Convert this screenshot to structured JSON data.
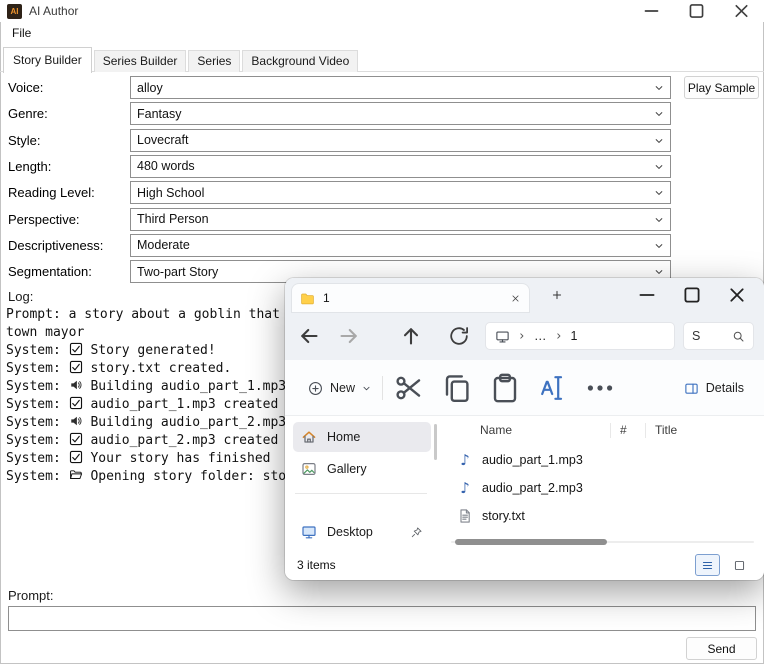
{
  "colors": {
    "accent_blue": "#2e62a8",
    "logo_orange": "#f0952e",
    "folder_yellow": "#ffd04a"
  },
  "app": {
    "title": "AI Author",
    "logo": "AI",
    "menu_items": [
      "File"
    ],
    "tabs": [
      "Story Builder",
      "Series Builder",
      "Series",
      "Background Video"
    ],
    "active_tab_index": 0,
    "fields": [
      {
        "label": "Voice:",
        "value": "alloy"
      },
      {
        "label": "Genre:",
        "value": "Fantasy"
      },
      {
        "label": "Style:",
        "value": "Lovecraft"
      },
      {
        "label": "Length:",
        "value": "480 words"
      },
      {
        "label": "Reading Level:",
        "value": "High School"
      },
      {
        "label": "Perspective:",
        "value": "Third Person"
      },
      {
        "label": "Descriptiveness:",
        "value": "Moderate"
      },
      {
        "label": "Segmentation:",
        "value": "Two-part Story"
      }
    ],
    "play_sample": "Play Sample",
    "log_label": "Log:",
    "log_lines": [
      {
        "prefix": "",
        "icon": null,
        "text": "Prompt: a story about a goblin that"
      },
      {
        "prefix": "",
        "icon": null,
        "text": "town mayor"
      },
      {
        "prefix": "System: ",
        "icon": "check",
        "text": "Story generated!"
      },
      {
        "prefix": "System: ",
        "icon": "check",
        "text": "story.txt created."
      },
      {
        "prefix": "System: ",
        "icon": "speaker",
        "text": "Building audio_part_1.mp3"
      },
      {
        "prefix": "System: ",
        "icon": "check",
        "text": "audio_part_1.mp3 created"
      },
      {
        "prefix": "System: ",
        "icon": "speaker",
        "text": "Building audio_part_2.mp3"
      },
      {
        "prefix": "System: ",
        "icon": "check",
        "text": "audio_part_2.mp3 created"
      },
      {
        "prefix": "System: ",
        "icon": "check",
        "text": "Your story has finished"
      },
      {
        "prefix": "System: ",
        "icon": "folder-open",
        "text": "Opening story folder: sto"
      }
    ],
    "prompt_label": "Prompt:",
    "prompt_value": "",
    "send": "Send"
  },
  "explorer": {
    "tab_title": "1",
    "breadcrumb": {
      "ellipsis": "…",
      "current": "1"
    },
    "search_value": "S",
    "toolbar": {
      "new": "New",
      "details": "Details"
    },
    "sidebar": [
      {
        "label": "Home",
        "icon": "home",
        "selected": true
      },
      {
        "label": "Gallery",
        "icon": "gallery",
        "selected": false,
        "divider_after": true
      },
      {
        "label": "Desktop",
        "icon": "desktop",
        "selected": false,
        "pinned": true
      }
    ],
    "columns": [
      "Name",
      "#",
      "Title"
    ],
    "files": [
      {
        "name": "audio_part_1.mp3",
        "icon": "audio"
      },
      {
        "name": "audio_part_2.mp3",
        "icon": "audio"
      },
      {
        "name": "story.txt",
        "icon": "text"
      }
    ],
    "status": "3 items"
  }
}
